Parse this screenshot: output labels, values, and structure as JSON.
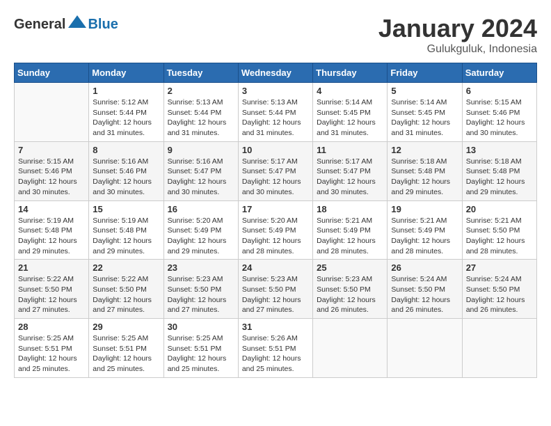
{
  "header": {
    "logo_general": "General",
    "logo_blue": "Blue",
    "month_title": "January 2024",
    "location": "Gulukguluk, Indonesia"
  },
  "calendar": {
    "weekdays": [
      "Sunday",
      "Monday",
      "Tuesday",
      "Wednesday",
      "Thursday",
      "Friday",
      "Saturday"
    ],
    "weeks": [
      [
        {
          "day": "",
          "sunrise": "",
          "sunset": "",
          "daylight": ""
        },
        {
          "day": "1",
          "sunrise": "Sunrise: 5:12 AM",
          "sunset": "Sunset: 5:44 PM",
          "daylight": "Daylight: 12 hours and 31 minutes."
        },
        {
          "day": "2",
          "sunrise": "Sunrise: 5:13 AM",
          "sunset": "Sunset: 5:44 PM",
          "daylight": "Daylight: 12 hours and 31 minutes."
        },
        {
          "day": "3",
          "sunrise": "Sunrise: 5:13 AM",
          "sunset": "Sunset: 5:44 PM",
          "daylight": "Daylight: 12 hours and 31 minutes."
        },
        {
          "day": "4",
          "sunrise": "Sunrise: 5:14 AM",
          "sunset": "Sunset: 5:45 PM",
          "daylight": "Daylight: 12 hours and 31 minutes."
        },
        {
          "day": "5",
          "sunrise": "Sunrise: 5:14 AM",
          "sunset": "Sunset: 5:45 PM",
          "daylight": "Daylight: 12 hours and 31 minutes."
        },
        {
          "day": "6",
          "sunrise": "Sunrise: 5:15 AM",
          "sunset": "Sunset: 5:46 PM",
          "daylight": "Daylight: 12 hours and 30 minutes."
        }
      ],
      [
        {
          "day": "7",
          "sunrise": "Sunrise: 5:15 AM",
          "sunset": "Sunset: 5:46 PM",
          "daylight": "Daylight: 12 hours and 30 minutes."
        },
        {
          "day": "8",
          "sunrise": "Sunrise: 5:16 AM",
          "sunset": "Sunset: 5:46 PM",
          "daylight": "Daylight: 12 hours and 30 minutes."
        },
        {
          "day": "9",
          "sunrise": "Sunrise: 5:16 AM",
          "sunset": "Sunset: 5:47 PM",
          "daylight": "Daylight: 12 hours and 30 minutes."
        },
        {
          "day": "10",
          "sunrise": "Sunrise: 5:17 AM",
          "sunset": "Sunset: 5:47 PM",
          "daylight": "Daylight: 12 hours and 30 minutes."
        },
        {
          "day": "11",
          "sunrise": "Sunrise: 5:17 AM",
          "sunset": "Sunset: 5:47 PM",
          "daylight": "Daylight: 12 hours and 30 minutes."
        },
        {
          "day": "12",
          "sunrise": "Sunrise: 5:18 AM",
          "sunset": "Sunset: 5:48 PM",
          "daylight": "Daylight: 12 hours and 29 minutes."
        },
        {
          "day": "13",
          "sunrise": "Sunrise: 5:18 AM",
          "sunset": "Sunset: 5:48 PM",
          "daylight": "Daylight: 12 hours and 29 minutes."
        }
      ],
      [
        {
          "day": "14",
          "sunrise": "Sunrise: 5:19 AM",
          "sunset": "Sunset: 5:48 PM",
          "daylight": "Daylight: 12 hours and 29 minutes."
        },
        {
          "day": "15",
          "sunrise": "Sunrise: 5:19 AM",
          "sunset": "Sunset: 5:48 PM",
          "daylight": "Daylight: 12 hours and 29 minutes."
        },
        {
          "day": "16",
          "sunrise": "Sunrise: 5:20 AM",
          "sunset": "Sunset: 5:49 PM",
          "daylight": "Daylight: 12 hours and 29 minutes."
        },
        {
          "day": "17",
          "sunrise": "Sunrise: 5:20 AM",
          "sunset": "Sunset: 5:49 PM",
          "daylight": "Daylight: 12 hours and 28 minutes."
        },
        {
          "day": "18",
          "sunrise": "Sunrise: 5:21 AM",
          "sunset": "Sunset: 5:49 PM",
          "daylight": "Daylight: 12 hours and 28 minutes."
        },
        {
          "day": "19",
          "sunrise": "Sunrise: 5:21 AM",
          "sunset": "Sunset: 5:49 PM",
          "daylight": "Daylight: 12 hours and 28 minutes."
        },
        {
          "day": "20",
          "sunrise": "Sunrise: 5:21 AM",
          "sunset": "Sunset: 5:50 PM",
          "daylight": "Daylight: 12 hours and 28 minutes."
        }
      ],
      [
        {
          "day": "21",
          "sunrise": "Sunrise: 5:22 AM",
          "sunset": "Sunset: 5:50 PM",
          "daylight": "Daylight: 12 hours and 27 minutes."
        },
        {
          "day": "22",
          "sunrise": "Sunrise: 5:22 AM",
          "sunset": "Sunset: 5:50 PM",
          "daylight": "Daylight: 12 hours and 27 minutes."
        },
        {
          "day": "23",
          "sunrise": "Sunrise: 5:23 AM",
          "sunset": "Sunset: 5:50 PM",
          "daylight": "Daylight: 12 hours and 27 minutes."
        },
        {
          "day": "24",
          "sunrise": "Sunrise: 5:23 AM",
          "sunset": "Sunset: 5:50 PM",
          "daylight": "Daylight: 12 hours and 27 minutes."
        },
        {
          "day": "25",
          "sunrise": "Sunrise: 5:23 AM",
          "sunset": "Sunset: 5:50 PM",
          "daylight": "Daylight: 12 hours and 26 minutes."
        },
        {
          "day": "26",
          "sunrise": "Sunrise: 5:24 AM",
          "sunset": "Sunset: 5:50 PM",
          "daylight": "Daylight: 12 hours and 26 minutes."
        },
        {
          "day": "27",
          "sunrise": "Sunrise: 5:24 AM",
          "sunset": "Sunset: 5:50 PM",
          "daylight": "Daylight: 12 hours and 26 minutes."
        }
      ],
      [
        {
          "day": "28",
          "sunrise": "Sunrise: 5:25 AM",
          "sunset": "Sunset: 5:51 PM",
          "daylight": "Daylight: 12 hours and 25 minutes."
        },
        {
          "day": "29",
          "sunrise": "Sunrise: 5:25 AM",
          "sunset": "Sunset: 5:51 PM",
          "daylight": "Daylight: 12 hours and 25 minutes."
        },
        {
          "day": "30",
          "sunrise": "Sunrise: 5:25 AM",
          "sunset": "Sunset: 5:51 PM",
          "daylight": "Daylight: 12 hours and 25 minutes."
        },
        {
          "day": "31",
          "sunrise": "Sunrise: 5:26 AM",
          "sunset": "Sunset: 5:51 PM",
          "daylight": "Daylight: 12 hours and 25 minutes."
        },
        {
          "day": "",
          "sunrise": "",
          "sunset": "",
          "daylight": ""
        },
        {
          "day": "",
          "sunrise": "",
          "sunset": "",
          "daylight": ""
        },
        {
          "day": "",
          "sunrise": "",
          "sunset": "",
          "daylight": ""
        }
      ]
    ]
  }
}
